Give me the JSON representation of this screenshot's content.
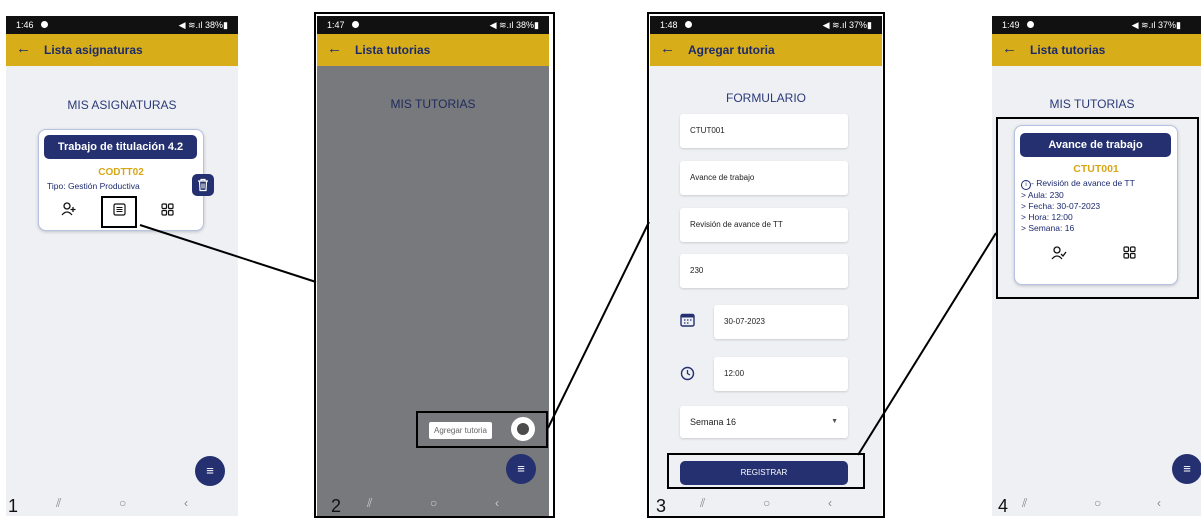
{
  "screens": [
    {
      "number": "1",
      "time": "1:46",
      "signal": "◀ ≋.ıl 38%▮",
      "appbar_title": "Lista asignaturas",
      "heading": "MIS ASIGNATURAS",
      "card": {
        "title": "Trabajo de titulación 4.2",
        "code": "CODTT02",
        "type": "Tipo: Gestión Productiva"
      },
      "icons": [
        "add-person-icon",
        "list-icon",
        "grid-icon",
        "trash-icon"
      ]
    },
    {
      "number": "2",
      "time": "1:47",
      "signal": "◀ ≋.ıl 38%▮",
      "appbar_title": "Lista tutorias",
      "heading": "MIS TUTORIAS",
      "add_label": "Agregar tutoria"
    },
    {
      "number": "3",
      "time": "1:48",
      "signal": "◀ ≋.ıl 37%▮",
      "appbar_title": "Agregar tutoria",
      "heading": "FORMULARIO",
      "fields": {
        "code": "CTUT001",
        "name": "Avance de trabajo",
        "description": "Revisión de avance de TT",
        "room": "230",
        "date": "30-07-2023",
        "hour": "12:00",
        "week": "Semana 16"
      },
      "submit_label": "REGISTRAR"
    },
    {
      "number": "4",
      "time": "1:49",
      "signal": "◀ ≋.ıl 37%▮",
      "appbar_title": "Lista tutorias",
      "heading": "MIS TUTORIAS",
      "card": {
        "title": "Avance de trabajo",
        "code": "CTUT001",
        "desc": "- Revisión de avance de TT",
        "aula": "Aula: 230",
        "fecha": "Fecha: 30-07-2023",
        "hora": "Hora: 12:00",
        "semana": "Semana: 16"
      }
    }
  ],
  "colors": {
    "appbar": "#d8ad1a",
    "primary": "#243070",
    "accent_code": "#d6a717",
    "overlay": "#77797d"
  }
}
